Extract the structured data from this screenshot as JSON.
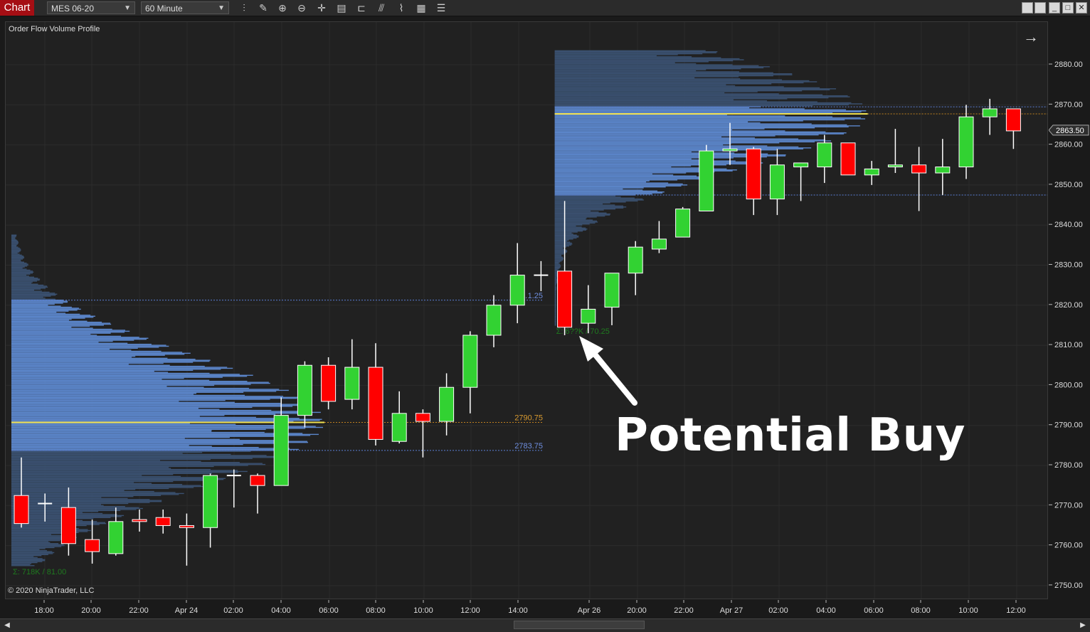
{
  "toolbar": {
    "tab_label": "Chart",
    "instrument": "MES 06-20",
    "interval": "60 Minute",
    "icons": [
      "bar-type-icon",
      "draw-tool-icon",
      "zoom-in-icon",
      "zoom-out-icon",
      "crosshair-icon",
      "data-box-icon",
      "templates-icon",
      "indicators-icon",
      "strategies-icon",
      "properties-icon",
      "more-icon"
    ]
  },
  "chart": {
    "indicator_name": "Order Flow Volume Profile",
    "copyright": "© 2020 NinjaTrader, LLC",
    "annotation": "Potential Buy"
  },
  "colors": {
    "up": "#32d232",
    "down": "#ff0000",
    "profile_dark": "#3a506f",
    "profile_value_area": "#5b85c9",
    "poc": "#f0e050"
  },
  "chart_data": {
    "type": "candlestick",
    "instrument": "MES 06-20",
    "interval": "60 Minute",
    "y_ticks": [
      "2880.00",
      "2870.00",
      "2860.00",
      "2850.00",
      "2840.00",
      "2830.00",
      "2820.00",
      "2810.00",
      "2800.00",
      "2790.00",
      "2780.00",
      "2770.00",
      "2760.00",
      "2750.00"
    ],
    "ylim": [
      2747.5,
      2892
    ],
    "last_price": "2863.50",
    "x_labels": [
      "18:00",
      "20:00",
      "22:00",
      "Apr 24",
      "02:00",
      "04:00",
      "06:00",
      "08:00",
      "10:00",
      "12:00",
      "14:00",
      "Apr 26",
      "20:00",
      "22:00",
      "Apr 27",
      "02:00",
      "04:00",
      "06:00",
      "08:00",
      "10:00",
      "12:00"
    ],
    "candles": [
      {
        "o": 2772.5,
        "h": 2782,
        "l": 2764.5,
        "c": 2765.5
      },
      {
        "o": 2770.5,
        "h": 2773,
        "l": 2766,
        "c": 2770.5
      },
      {
        "o": 2769.5,
        "h": 2774.5,
        "l": 2757.5,
        "c": 2760.5
      },
      {
        "o": 2761.5,
        "h": 2766.5,
        "l": 2755.5,
        "c": 2758.5
      },
      {
        "o": 2758,
        "h": 2769.5,
        "l": 2757.5,
        "c": 2766
      },
      {
        "o": 2766.5,
        "h": 2769,
        "l": 2763.5,
        "c": 2766
      },
      {
        "o": 2767,
        "h": 2769,
        "l": 2763,
        "c": 2765
      },
      {
        "o": 2765,
        "h": 2768,
        "l": 2755,
        "c": 2764.5
      },
      {
        "o": 2764.5,
        "h": 2778,
        "l": 2759.5,
        "c": 2777.5
      },
      {
        "o": 2777.5,
        "h": 2779,
        "l": 2769.5,
        "c": 2777.5
      },
      {
        "o": 2777.5,
        "h": 2778,
        "l": 2768,
        "c": 2775
      },
      {
        "o": 2775,
        "h": 2797,
        "l": 2775,
        "c": 2792.5
      },
      {
        "o": 2792.5,
        "h": 2806,
        "l": 2789.5,
        "c": 2805
      },
      {
        "o": 2805,
        "h": 2807,
        "l": 2794,
        "c": 2796
      },
      {
        "o": 2796.5,
        "h": 2811.5,
        "l": 2794,
        "c": 2804.5
      },
      {
        "o": 2804.5,
        "h": 2810.5,
        "l": 2785,
        "c": 2786.5
      },
      {
        "o": 2786,
        "h": 2798.5,
        "l": 2785.5,
        "c": 2793
      },
      {
        "o": 2793,
        "h": 2794,
        "l": 2782,
        "c": 2791
      },
      {
        "o": 2791,
        "h": 2803,
        "l": 2787.5,
        "c": 2799.5
      },
      {
        "o": 2799.5,
        "h": 2813.5,
        "l": 2793,
        "c": 2812.5
      },
      {
        "o": 2812.5,
        "h": 2822.5,
        "l": 2809.5,
        "c": 2820
      },
      {
        "o": 2820,
        "h": 2835.5,
        "l": 2815.5,
        "c": 2827.5
      },
      {
        "o": 2827.5,
        "h": 2831,
        "l": 2823.5,
        "c": 2827.5
      },
      {
        "o": 2828.5,
        "h": 2846,
        "l": 2812.5,
        "c": 2814.5
      },
      {
        "o": 2815.5,
        "h": 2825,
        "l": 2813,
        "c": 2819
      },
      {
        "o": 2819.5,
        "h": 2828,
        "l": 2815,
        "c": 2828
      },
      {
        "o": 2828,
        "h": 2836,
        "l": 2822.5,
        "c": 2834.5
      },
      {
        "o": 2834,
        "h": 2841,
        "l": 2833,
        "c": 2836.5
      },
      {
        "o": 2837,
        "h": 2844.5,
        "l": 2837,
        "c": 2844
      },
      {
        "o": 2843.5,
        "h": 2860,
        "l": 2843.5,
        "c": 2858.5
      },
      {
        "o": 2858.5,
        "h": 2865.5,
        "l": 2855,
        "c": 2859
      },
      {
        "o": 2859,
        "h": 2859.5,
        "l": 2842.5,
        "c": 2846.5
      },
      {
        "o": 2846.5,
        "h": 2859,
        "l": 2842.5,
        "c": 2855
      },
      {
        "o": 2854.5,
        "h": 2855.5,
        "l": 2846,
        "c": 2855.5
      },
      {
        "o": 2854.5,
        "h": 2862.5,
        "l": 2850.5,
        "c": 2860.5
      },
      {
        "o": 2860.5,
        "h": 2860.5,
        "l": 2852.5,
        "c": 2852.5
      },
      {
        "o": 2852.5,
        "h": 2856,
        "l": 2850,
        "c": 2854
      },
      {
        "o": 2854.5,
        "h": 2864,
        "l": 2853,
        "c": 2855
      },
      {
        "o": 2855,
        "h": 2859.5,
        "l": 2843.5,
        "c": 2853
      },
      {
        "o": 2853,
        "h": 2861.5,
        "l": 2847.5,
        "c": 2854.5
      },
      {
        "o": 2854.5,
        "h": 2870,
        "l": 2851.5,
        "c": 2867
      },
      {
        "o": 2867,
        "h": 2871.5,
        "l": 2862.5,
        "c": 2869
      },
      {
        "o": 2869,
        "h": 2869,
        "l": 2859,
        "c": 2863.5
      }
    ],
    "profiles": [
      {
        "left_bar": 0,
        "right_bar": 22,
        "poc": "2790.75",
        "val": "2783.75",
        "vah": "…1.25",
        "summary": "Σ: 718K / 81.00",
        "hi": 2837.5,
        "lo": 2755,
        "vah_price": 2821.25,
        "val_price": 2783.75,
        "poc_price": 2790.75
      },
      {
        "left_bar": 23,
        "right_bar": 42,
        "poc": "",
        "val": "",
        "vah": "",
        "summary": "Σ: 6??K / 70.25",
        "hi": 2883.5,
        "lo": 2815,
        "vah_price": 2869.5,
        "val_price": 2847.5,
        "poc_price": 2867.75
      }
    ]
  }
}
